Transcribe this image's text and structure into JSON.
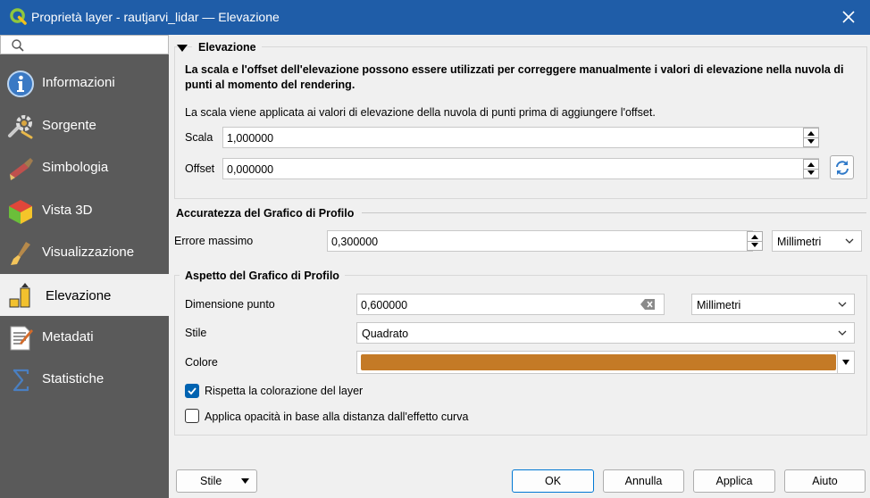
{
  "window": {
    "title": "Proprietà layer - rautjarvi_lidar — Elevazione"
  },
  "sidebar": {
    "search_placeholder": "",
    "items": [
      {
        "label": "Informazioni",
        "icon": "info-icon"
      },
      {
        "label": "Sorgente",
        "icon": "source-settings-icon"
      },
      {
        "label": "Simbologia",
        "icon": "symbology-brush-icon"
      },
      {
        "label": "Vista 3D",
        "icon": "cube-3d-icon"
      },
      {
        "label": "Visualizzazione",
        "icon": "rendering-brush-icon"
      },
      {
        "label": "Elevazione",
        "icon": "elevation-icon",
        "active": true
      },
      {
        "label": "Metadati",
        "icon": "metadata-icon"
      },
      {
        "label": "Statistiche",
        "icon": "sigma-icon"
      }
    ]
  },
  "elevation": {
    "section_title": "Elevazione",
    "description": "La scala e l'offset dell'elevazione possono essere utilizzati per correggere manualmente i valori di elevazione nella nuvola di punti al momento del rendering.",
    "note": "La scala viene applicata ai valori di elevazione della nuvola di punti prima di aggiungere l'offset.",
    "scale_label": "Scala",
    "scale_value": "1,000000",
    "offset_label": "Offset",
    "offset_value": "0,000000"
  },
  "accuracy": {
    "section_title": "Accuratezza del Grafico di Profilo",
    "max_error_label": "Errore massimo",
    "max_error_value": "0,300000",
    "unit": "Millimetri"
  },
  "appearance": {
    "section_title": "Aspetto del Grafico di Profilo",
    "point_size_label": "Dimensione punto",
    "point_size_value": "0,600000",
    "point_size_unit": "Millimetri",
    "style_label": "Stile",
    "style_value": "Quadrato",
    "color_label": "Colore",
    "color_value": "#c47a26",
    "respect_color_label": "Rispetta la colorazione del layer",
    "respect_color_checked": true,
    "opacity_label": "Applica opacità in base alla distanza dall'effetto curva",
    "opacity_checked": false
  },
  "footer": {
    "style_button": "Stile",
    "ok": "OK",
    "cancel": "Annulla",
    "apply": "Applica",
    "help": "Aiuto"
  }
}
